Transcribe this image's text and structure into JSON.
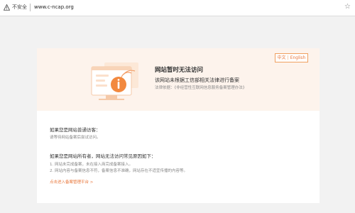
{
  "browser": {
    "security_label": "不安全",
    "url": "www.c-ncap.org"
  },
  "hero": {
    "lang_zh": "中文",
    "lang_en": "English",
    "title": "网站暂时无法访问",
    "subtitle": "该网站未根据工信部相关法律进行备案",
    "law_note": "法律依据：《非经营性互联网信息服务备案管理办法》"
  },
  "visitor": {
    "heading": "如果您是网站普通访客：",
    "text": "请等待网站备案后尝试访问。"
  },
  "owner": {
    "heading": "如果您是网站所有者，网站无法访问常见原因如下：",
    "reasons": [
      "1. 网站未完成备案，未在接入商完成备案接入。",
      "2. 网站内容与备案信息不符，备案信息不准确，网站存在不适宜传播的内容等。"
    ],
    "link": "点击进入备案管理平台 >"
  },
  "colors": {
    "accent": "#e8763a",
    "hero_bg": "#fdf3ec"
  }
}
